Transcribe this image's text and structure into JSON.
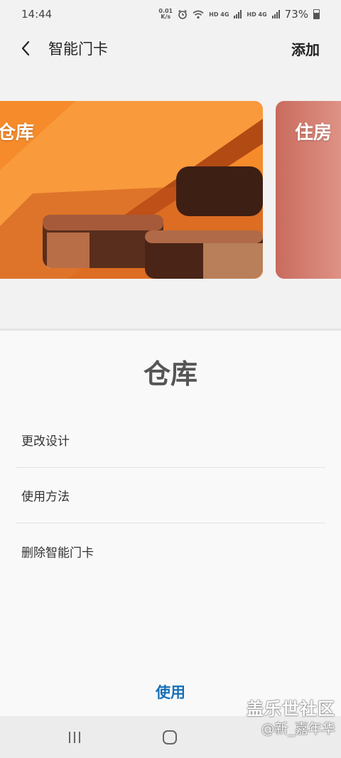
{
  "status_bar": {
    "time": "14:44",
    "net_speed_value": "0.01",
    "net_speed_unit": "K/s",
    "network_1": "HD 4G",
    "network_2": "HD 4G",
    "battery": "73%"
  },
  "app_bar": {
    "title": "智能门卡",
    "add_label": "添加"
  },
  "cards": [
    {
      "label": "仓库"
    },
    {
      "label": "住房"
    }
  ],
  "sheet": {
    "title": "仓库",
    "menu": [
      {
        "label": "更改设计"
      },
      {
        "label": "使用方法"
      },
      {
        "label": "删除智能门卡"
      }
    ],
    "use_label": "使用"
  },
  "watermark": {
    "line1": "盖乐世社区",
    "line2": "@新_嘉年华"
  }
}
